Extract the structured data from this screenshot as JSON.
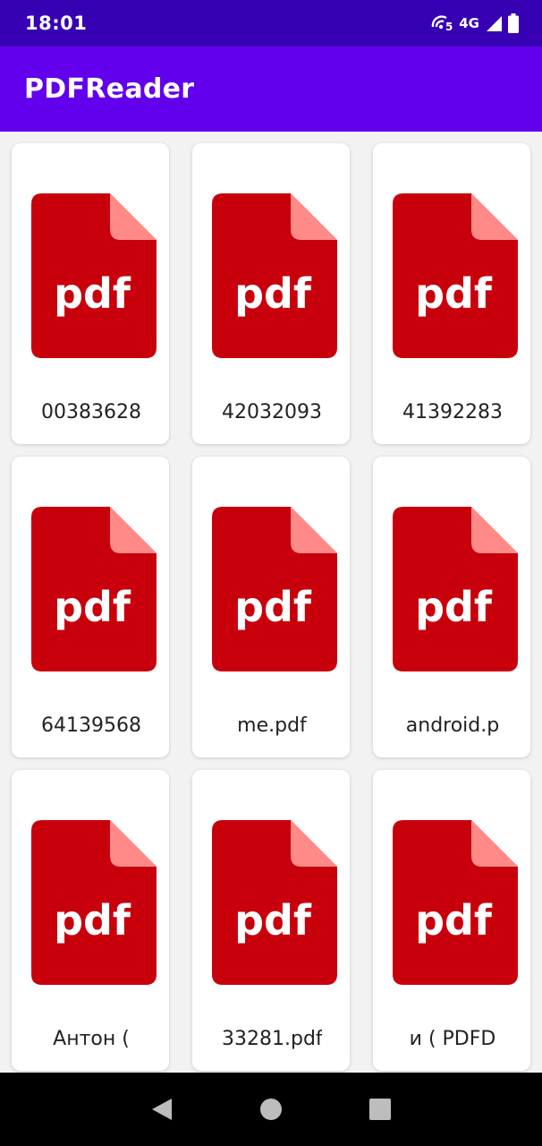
{
  "status_bar": {
    "time": "18:01",
    "network": "4G",
    "icons": [
      "hotspot-icon",
      "signal-icon",
      "battery-icon"
    ]
  },
  "app_bar": {
    "title": "PDFReader"
  },
  "files": [
    {
      "name": "00383628",
      "icon_label": "pdf"
    },
    {
      "name": "42032093",
      "icon_label": "pdf"
    },
    {
      "name": "41392283",
      "icon_label": "pdf"
    },
    {
      "name": "64139568",
      "icon_label": "pdf"
    },
    {
      "name": "me.pdf",
      "icon_label": "pdf"
    },
    {
      "name": "android.p",
      "icon_label": "pdf"
    },
    {
      "name": "Антон (",
      "icon_label": "pdf"
    },
    {
      "name": "33281.pdf",
      "icon_label": "pdf"
    },
    {
      "name": "и ( PDFD",
      "icon_label": "pdf"
    }
  ],
  "colors": {
    "status_bar": "#3700b3",
    "app_bar": "#6200ee",
    "pdf_red": "#c8000c",
    "pdf_fold": "#ff8a88"
  },
  "nav_bar": {
    "buttons": [
      "back-icon",
      "home-icon",
      "recents-icon"
    ]
  }
}
